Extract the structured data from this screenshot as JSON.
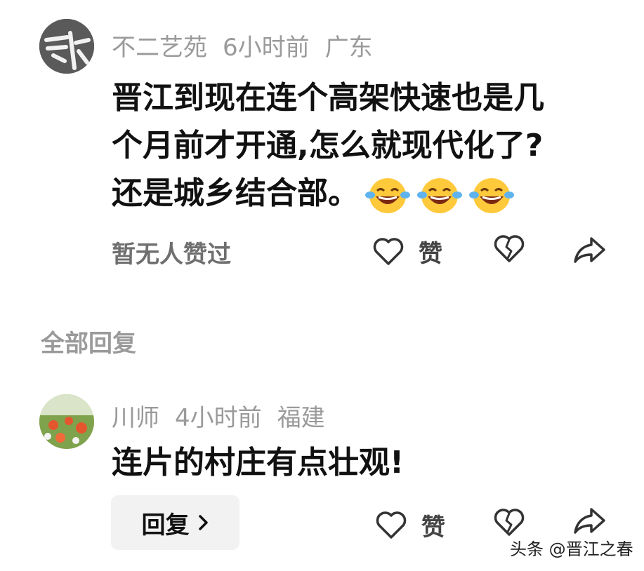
{
  "comment": {
    "author": "不二艺苑",
    "time": "6小时前",
    "location": "广东",
    "lines": [
      "晋江到现在连个高架快速也是几",
      "个月前才开通,怎么就现代化了?",
      "还是城乡结合部。"
    ],
    "emoji": [
      "laughing-tears-emoji",
      "laughing-tears-emoji",
      "laughing-tears-emoji"
    ],
    "likes_text": "暂无人赞过",
    "like_label": "赞"
  },
  "replies_section": {
    "title": "全部回复"
  },
  "reply": {
    "author": "川师",
    "time": "4小时前",
    "location": "福建",
    "text": "连片的村庄有点壮观!",
    "reply_button": "回复",
    "like_label": "赞"
  },
  "watermark": "头条 @晋江之春",
  "colors": {
    "meta_gray": "#9a9a9a",
    "text": "#111111",
    "emoji_yellow": "#ffc93c",
    "reply_bg": "#f2f2f2"
  }
}
